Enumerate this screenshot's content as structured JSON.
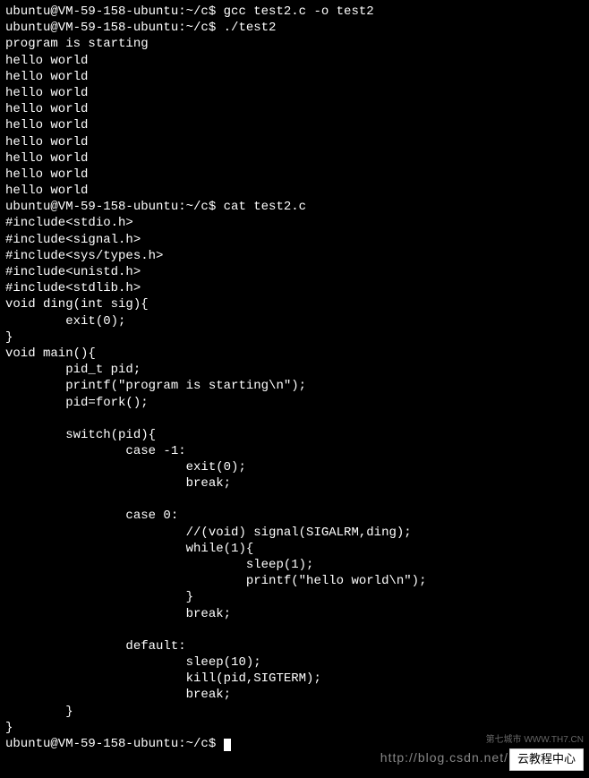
{
  "terminal": {
    "lines": [
      "ubuntu@VM-59-158-ubuntu:~/c$ gcc test2.c -o test2",
      "ubuntu@VM-59-158-ubuntu:~/c$ ./test2",
      "program is starting",
      "hello world",
      "hello world",
      "hello world",
      "hello world",
      "hello world",
      "hello world",
      "hello world",
      "hello world",
      "hello world",
      "ubuntu@VM-59-158-ubuntu:~/c$ cat test2.c",
      "#include<stdio.h>",
      "#include<signal.h>",
      "#include<sys/types.h>",
      "#include<unistd.h>",
      "#include<stdlib.h>",
      "void ding(int sig){",
      "        exit(0);",
      "}",
      "void main(){",
      "        pid_t pid;",
      "        printf(\"program is starting\\n\");",
      "        pid=fork();",
      "",
      "        switch(pid){",
      "                case -1:",
      "                        exit(0);",
      "                        break;",
      "",
      "                case 0:",
      "                        //(void) signal(SIGALRM,ding);",
      "                        while(1){",
      "                                sleep(1);",
      "                                printf(\"hello world\\n\");",
      "                        }",
      "                        break;",
      "",
      "                default:",
      "                        sleep(10);",
      "                        kill(pid,SIGTERM);",
      "                        break;",
      "        }",
      "}"
    ],
    "prompt_final": "ubuntu@VM-59-158-ubuntu:~/c$ "
  },
  "watermark": {
    "url": "http://blog.csdn.net/",
    "sub": "第七城市  WWW.TH7.CN",
    "badge": "云教程中心"
  }
}
